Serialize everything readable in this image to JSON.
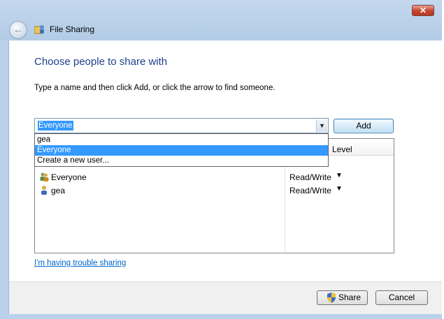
{
  "window": {
    "close_label": "✕",
    "app_title": "File Sharing"
  },
  "main": {
    "heading": "Choose people to share with",
    "instruction": "Type a name and then click Add, or click the arrow to find someone."
  },
  "combo": {
    "value": "Everyone",
    "add_label": "Add",
    "dropdown_options": [
      "gea",
      "Everyone",
      "Create a new user..."
    ],
    "selected_index": 1
  },
  "list": {
    "column_header": "Level",
    "rows": [
      {
        "name": "Everyone",
        "permission": "Read/Write",
        "icon": "group-users-icon"
      },
      {
        "name": "gea",
        "permission": "Read/Write",
        "icon": "user-icon"
      }
    ]
  },
  "footer": {
    "trouble_link": "I'm having trouble sharing",
    "share_label": "Share",
    "cancel_label": "Cancel"
  },
  "colors": {
    "accent": "#3399ff",
    "heading": "#1e3f8a",
    "link": "#0066cc",
    "frame": "#b9d1ea",
    "close": "#c7432c"
  }
}
